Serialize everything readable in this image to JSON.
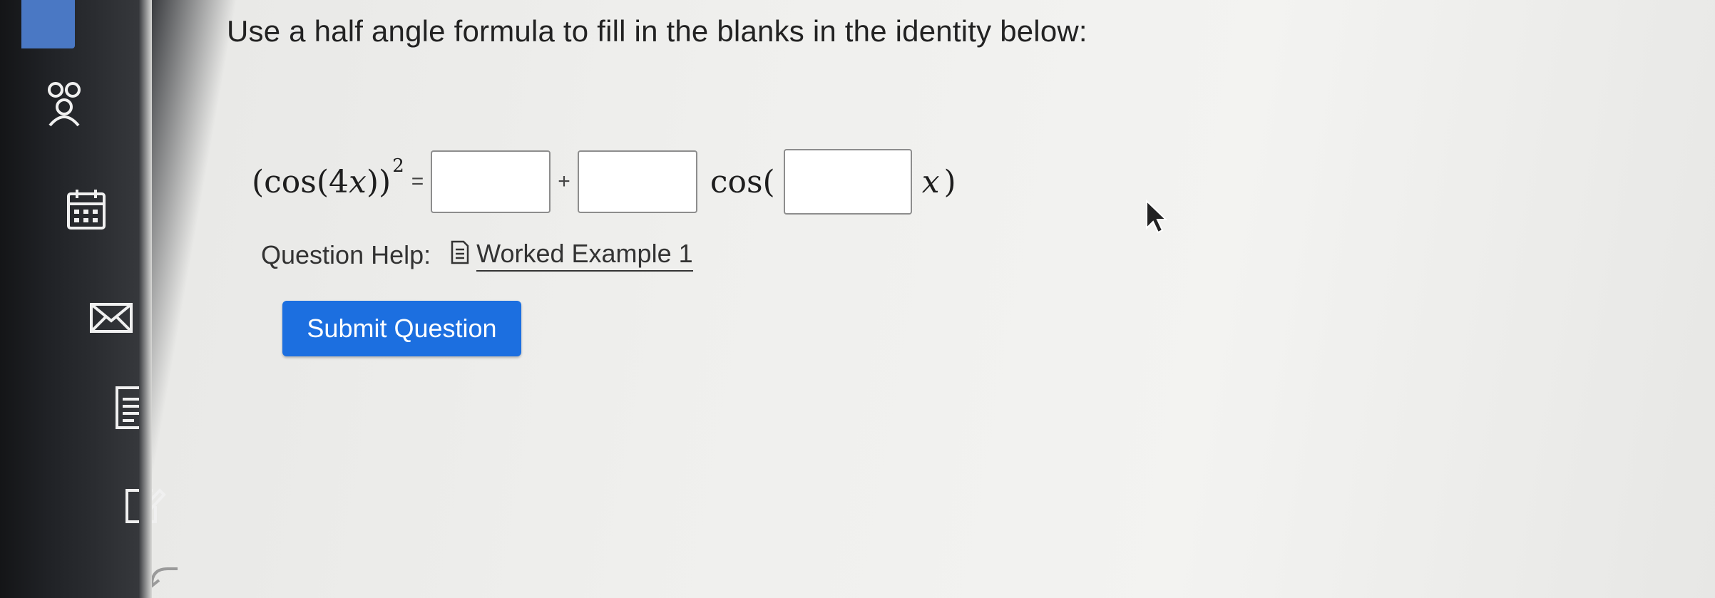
{
  "question": {
    "instruction": "Use a half angle formula to fill in the blanks in the identity below:"
  },
  "equation": {
    "lhs_open": "(cos(4",
    "lhs_var": "x",
    "lhs_close": "))",
    "exponent": "2",
    "equals": "=",
    "plus": "+",
    "cos_open": "cos(",
    "var": "x",
    "close": ")",
    "blank1_value": "",
    "blank2_value": "",
    "blank3_value": ""
  },
  "help": {
    "label": "Question Help:",
    "link_text": "Worked Example 1"
  },
  "actions": {
    "submit_label": "Submit Question"
  },
  "icons": {
    "sidebar": [
      "people-icon",
      "calendar-icon",
      "mail-icon",
      "document-list-icon",
      "edit-icon",
      "back-arrow-icon"
    ],
    "help": "document-icon"
  },
  "colors": {
    "submit_button": "#1c6fe0",
    "sidebar_tab": "#4a78c4"
  }
}
